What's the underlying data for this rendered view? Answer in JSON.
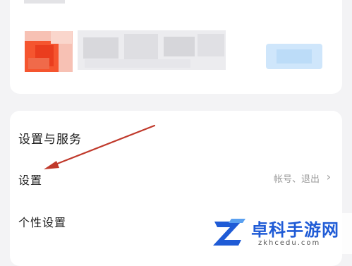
{
  "settings_section": {
    "title": "设置与服务",
    "rows": [
      {
        "label": "设置",
        "hint": "帐号、退出",
        "chevron": "›"
      },
      {
        "label": "个性设置"
      }
    ]
  },
  "watermark": {
    "title": "卓科手游网",
    "domain": "zkhcedu.com"
  },
  "colors": {
    "annotation_arrow": "#c0392b",
    "watermark_blue": "#1f5bd6",
    "card_background": "#ffffff",
    "page_background": "#f3f3f5"
  },
  "icons": [
    "chevron-right-icon",
    "watermark-logo-icon",
    "annotation-arrow"
  ]
}
